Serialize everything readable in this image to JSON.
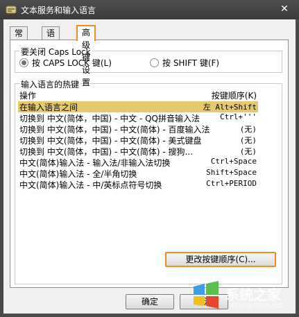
{
  "window": {
    "title": "文本服务和输入语言"
  },
  "tabs": [
    {
      "label": "常规"
    },
    {
      "label": "语言栏"
    },
    {
      "label": "高级键设置"
    }
  ],
  "caps_group": {
    "label": "要关闭 Caps Lock",
    "options": [
      {
        "label": "按 CAPS LOCK 键(L)",
        "selected": true
      },
      {
        "label": "按 SHIFT 键(F)",
        "selected": false
      }
    ]
  },
  "hotkeys_group": {
    "label": "输入语言的热键",
    "columns": {
      "action": "操作",
      "key": "按键顺序(K)"
    },
    "rows": [
      {
        "action": "在输入语言之间",
        "key": "左 Alt+Shift",
        "selected": true
      },
      {
        "action": "切换到 中文(简体，中国) - 中文 - QQ拼音输入法",
        "key": "Ctrl+'''"
      },
      {
        "action": "切换到 中文(简体，中国) - 中文(简体) - 百度输入法",
        "key": "(无)"
      },
      {
        "action": "切换到 中文(简体，中国) - 中文(简体) - 美式键盘",
        "key": "(无)"
      },
      {
        "action": "切换到 中文(简体，中国) - 中文(简体) - 搜狗...",
        "key": "(无)"
      },
      {
        "action": "中文(简体)输入法 - 输入法/非输入法切换",
        "key": "Ctrl+Space"
      },
      {
        "action": "中文(简体)输入法 - 全/半角切换",
        "key": "Shift+Space"
      },
      {
        "action": "中文(简体)输入法 - 中/英标点符号切换",
        "key": "Ctrl+PERIOD"
      }
    ]
  },
  "buttons": {
    "change_sequence": "更改按键顺序(C)...",
    "ok": "确定",
    "cancel": "取消"
  },
  "watermark": {
    "text": "系统之家",
    "url": "xitongzhijia.net"
  },
  "colors": {
    "accent": "#f08a24",
    "selection": "#e6c86e",
    "titlebar": "#3a3a3a"
  }
}
